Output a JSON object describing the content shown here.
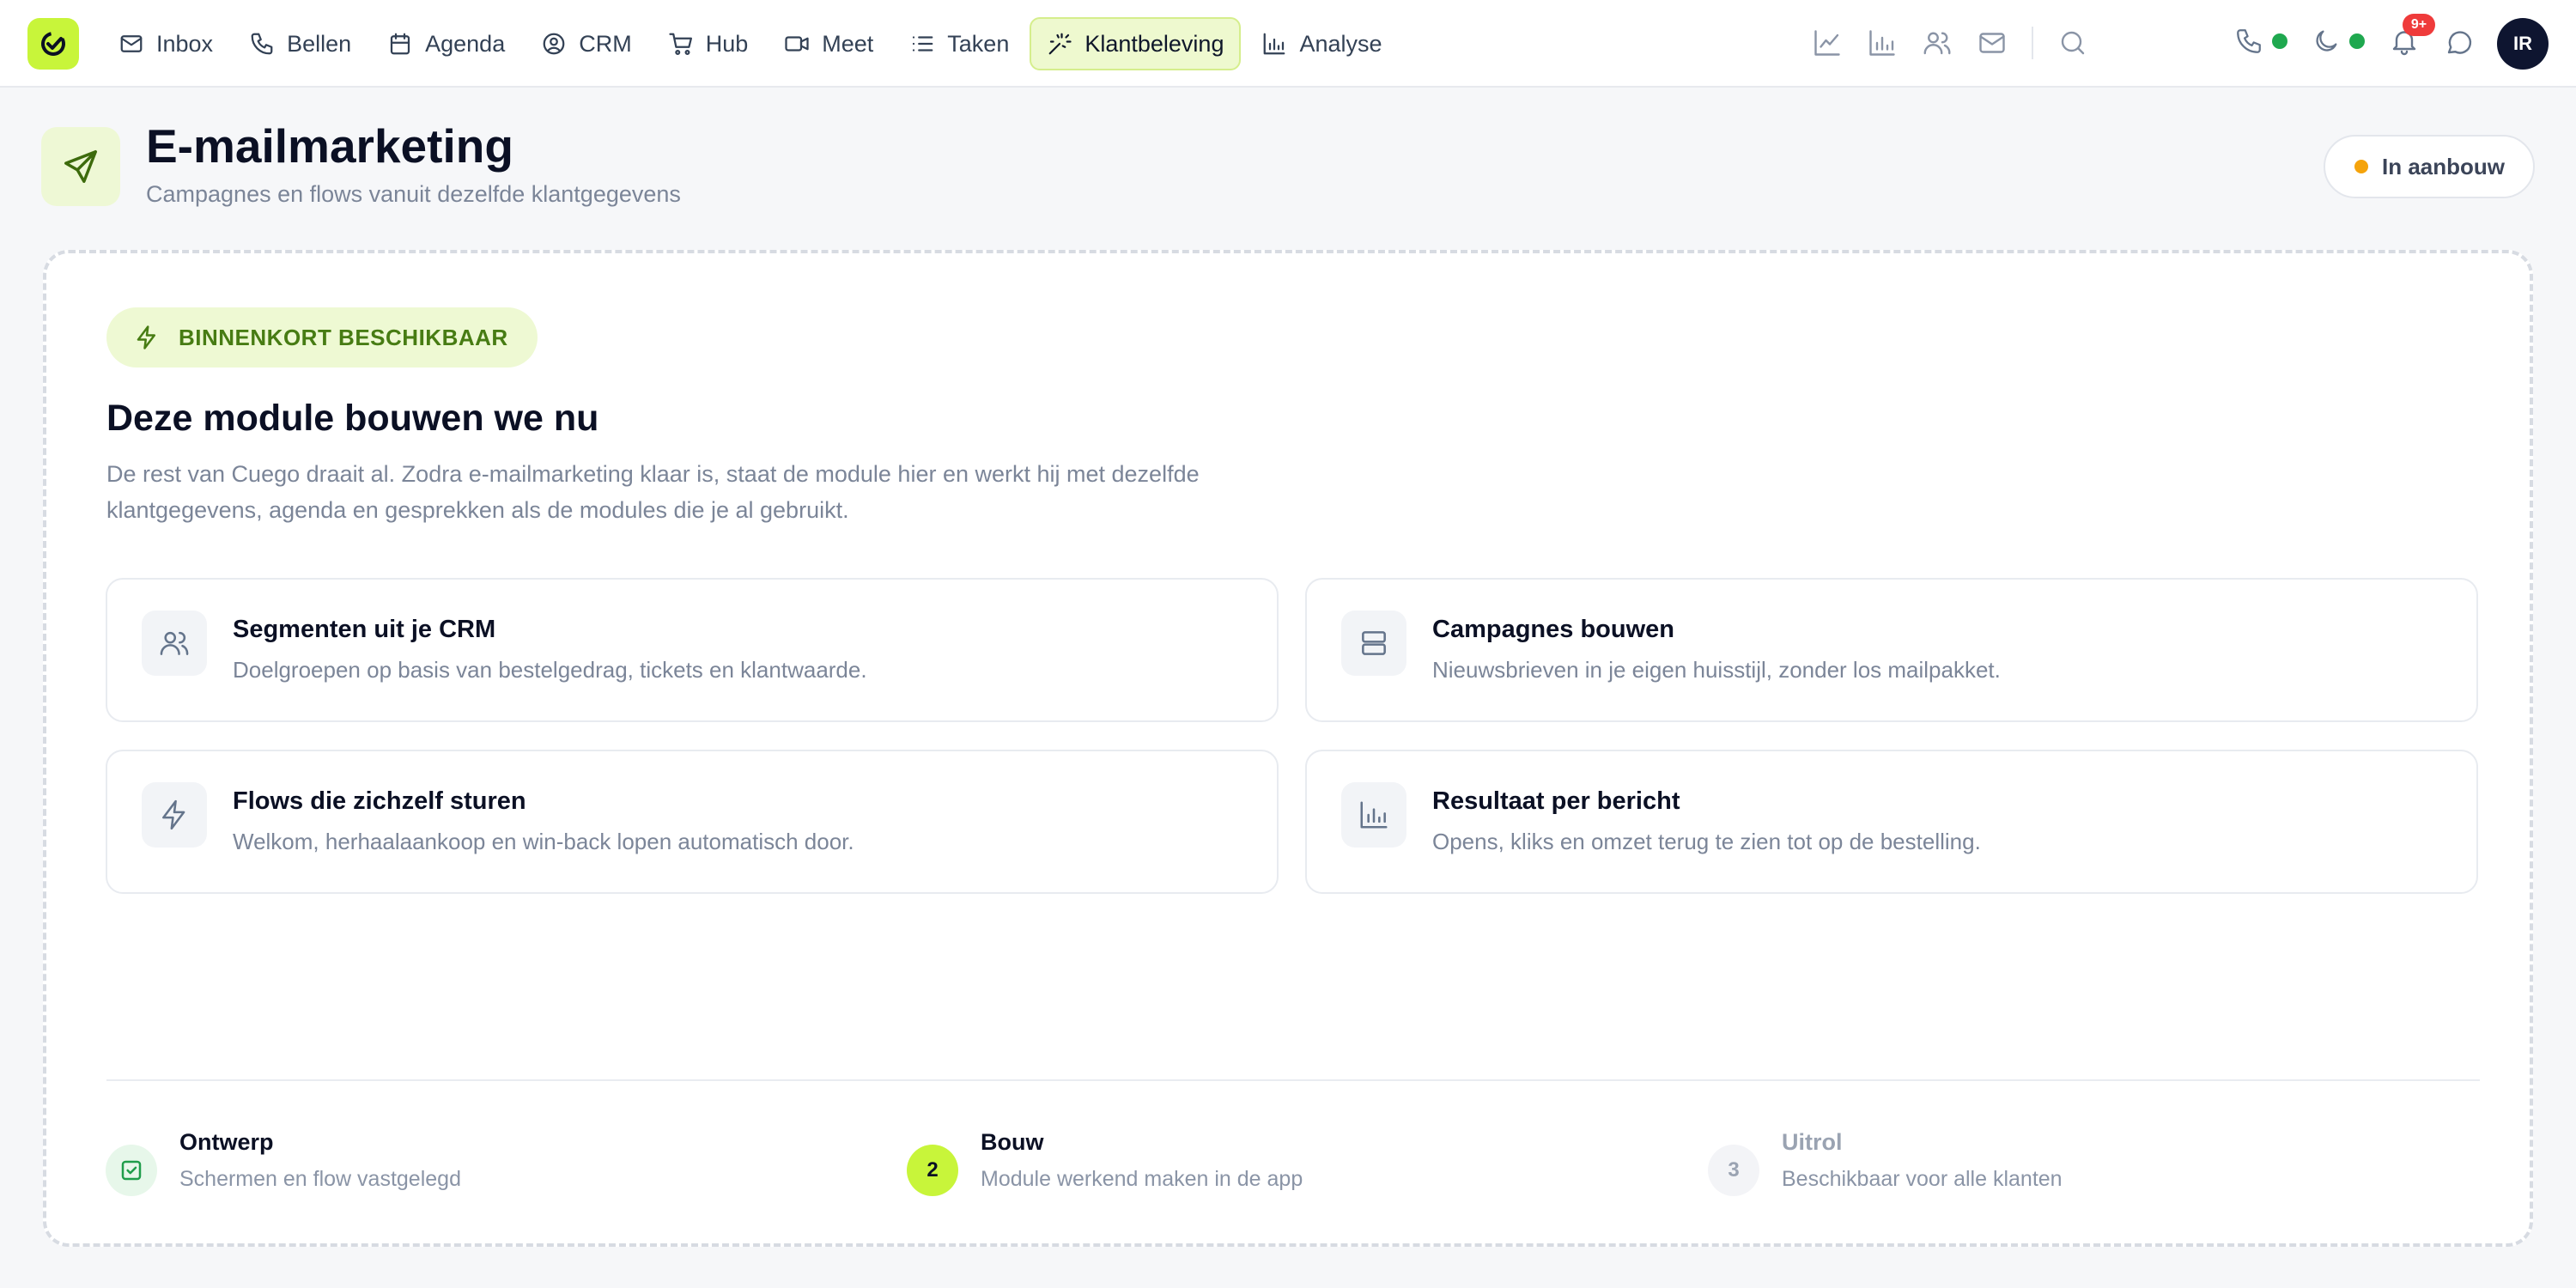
{
  "nav": {
    "items": [
      {
        "label": "Inbox",
        "icon": "mail-icon"
      },
      {
        "label": "Bellen",
        "icon": "phone-icon"
      },
      {
        "label": "Agenda",
        "icon": "calendar-icon"
      },
      {
        "label": "CRM",
        "icon": "user-circle-icon"
      },
      {
        "label": "Hub",
        "icon": "cart-icon"
      },
      {
        "label": "Meet",
        "icon": "video-icon"
      },
      {
        "label": "Taken",
        "icon": "list-icon"
      },
      {
        "label": "Klantbeleving",
        "icon": "sparkle-icon",
        "active": true
      },
      {
        "label": "Analyse",
        "icon": "bar-chart-icon"
      }
    ],
    "notification_count": "9+",
    "avatar_initials": "IR",
    "accent_color": "#c8f53a"
  },
  "header": {
    "title": "E-mailmarketing",
    "subtitle": "Campagnes en flows vanuit dezelfde klantgegevens",
    "status_label": "In aanbouw",
    "status_color": "#f5a30b"
  },
  "module": {
    "badge": "BINNENKORT BESCHIKBAAR",
    "heading": "Deze module bouwen we nu",
    "lead": "De rest van Cuego draait al. Zodra e-mailmarketing klaar is, staat de module hier en werkt hij met dezelfde klantgegevens, agenda en gesprekken als de modules die je al gebruikt.",
    "features": [
      {
        "title": "Segmenten uit je CRM",
        "desc": "Doelgroepen op basis van bestelgedrag, tickets en klantwaarde.",
        "icon": "users-icon"
      },
      {
        "title": "Campagnes bouwen",
        "desc": "Nieuwsbrieven in je eigen huisstijl, zonder los mailpakket.",
        "icon": "layout-icon"
      },
      {
        "title": "Flows die zichzelf sturen",
        "desc": "Welkom, herhaalaankoop en win-back lopen automatisch door.",
        "icon": "bolt-icon"
      },
      {
        "title": "Resultaat per bericht",
        "desc": "Opens, kliks en omzet terug te zien tot op de bestelling.",
        "icon": "bar-chart-icon"
      }
    ],
    "steps": [
      {
        "title": "Ontwerp",
        "desc": "Schermen en flow vastgelegd",
        "state": "done"
      },
      {
        "number": "2",
        "title": "Bouw",
        "desc": "Module werkend maken in de app",
        "state": "current"
      },
      {
        "number": "3",
        "title": "Uitrol",
        "desc": "Beschikbaar voor alle klanten",
        "state": "upcoming"
      }
    ]
  }
}
